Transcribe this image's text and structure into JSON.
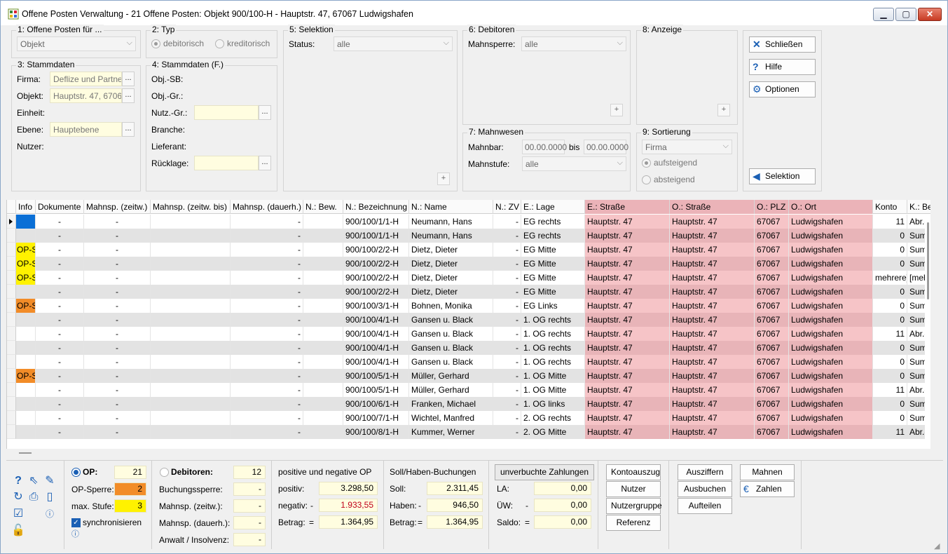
{
  "window": {
    "title": "Offene Posten Verwaltung - 21 Offene Posten:  Objekt 900/100-H - Hauptstr. 47, 67067 Ludwigshafen"
  },
  "panel1": {
    "label": "1: Offene Posten für ...",
    "select": "Objekt"
  },
  "panel2": {
    "label": "2: Typ",
    "opt1": "debitorisch",
    "opt2": "kreditorisch"
  },
  "panel3": {
    "label": "3: Stammdaten",
    "firma_l": "Firma:",
    "firma_v": "Deflize und Partne",
    "objekt_l": "Objekt:",
    "objekt_v": "Hauptstr. 47, 6706",
    "einheit_l": "Einheit:",
    "ebene_l": "Ebene:",
    "ebene_v": "Hauptebene",
    "nutzer_l": "Nutzer:"
  },
  "panel4": {
    "label": "4: Stammdaten (F.)",
    "objsb": "Obj.-SB:",
    "objgr": "Obj.-Gr.:",
    "nutzgr": "Nutz.-Gr.:",
    "branche": "Branche:",
    "lieferant": "Lieferant:",
    "ruecklage": "Rücklage:"
  },
  "panel5": {
    "label": "5: Selektion",
    "status_l": "Status:",
    "status_v": "alle"
  },
  "panel6": {
    "label": "6: Debitoren",
    "mahnsperre_l": "Mahnsperre:",
    "mahnsperre_v": "alle"
  },
  "panel7": {
    "label": "7: Mahnwesen",
    "mahnbar_l": "Mahnbar:",
    "from": "00.00.0000",
    "bis": "bis",
    "to": "00.00.0000",
    "stufe_l": "Mahnstufe:",
    "stufe_v": "alle"
  },
  "panel8": {
    "label": "8: Anzeige"
  },
  "panel9": {
    "label": "9: Sortierung",
    "select": "Firma",
    "asc": "aufsteigend",
    "desc": "absteigend"
  },
  "buttons": {
    "schliessen": "Schließen",
    "hilfe": "Hilfe",
    "optionen": "Optionen",
    "selektion": "Selektion"
  },
  "columns": [
    "Info",
    "Dokumente",
    "Mahnsp. (zeitw.)",
    "Mahnsp. (zeitw. bis)",
    "Mahnsp. (dauerh.)",
    "N.: Bew.",
    "N.: Bezeichnung",
    "N.: Name",
    "N.: ZV",
    "E.: Lage",
    "E.: Straße",
    "O.: Straße",
    "O.: PLZ",
    "O.: Ort",
    "Konto",
    "K.: Be"
  ],
  "rows": [
    {
      "info": "",
      "dok": "-",
      "mz": "-",
      "mzb": "",
      "md": "-",
      "bew": "",
      "bez": "900/100/1/1-H",
      "name": "Neumann, Hans",
      "zv": "-",
      "lage": "EG rechts",
      "es": "Hauptstr. 47",
      "os": "Hauptstr. 47",
      "plz": "67067",
      "ort": "Ludwigshafen",
      "konto": "11",
      "kb": "Abr.-I"
    },
    {
      "info": "",
      "dok": "-",
      "mz": "-",
      "mzb": "",
      "md": "-",
      "bew": "",
      "bez": "900/100/1/1-H",
      "name": "Neumann, Hans",
      "zv": "-",
      "lage": "EG rechts",
      "es": "Hauptstr. 47",
      "os": "Hauptstr. 47",
      "plz": "67067",
      "ort": "Ludwigshafen",
      "konto": "0",
      "kb": "Sumr"
    },
    {
      "info": "OP-S",
      "dok": "-",
      "mz": "-",
      "mzb": "",
      "md": "-",
      "bew": "",
      "bez": "900/100/2/2-H",
      "name": "Dietz, Dieter",
      "zv": "-",
      "lage": "EG Mitte",
      "es": "Hauptstr. 47",
      "os": "Hauptstr. 47",
      "plz": "67067",
      "ort": "Ludwigshafen",
      "konto": "0",
      "kb": "Sumr"
    },
    {
      "info": "OP-S",
      "dok": "-",
      "mz": "-",
      "mzb": "",
      "md": "-",
      "bew": "",
      "bez": "900/100/2/2-H",
      "name": "Dietz, Dieter",
      "zv": "-",
      "lage": "EG Mitte",
      "es": "Hauptstr. 47",
      "os": "Hauptstr. 47",
      "plz": "67067",
      "ort": "Ludwigshafen",
      "konto": "0",
      "kb": "Sumr"
    },
    {
      "info": "OP-S",
      "dok": "-",
      "mz": "-",
      "mzb": "",
      "md": "-",
      "bew": "",
      "bez": "900/100/2/2-H",
      "name": "Dietz, Dieter",
      "zv": "-",
      "lage": "EG Mitte",
      "es": "Hauptstr. 47",
      "os": "Hauptstr. 47",
      "plz": "67067",
      "ort": "Ludwigshafen",
      "konto": "mehrere]",
      "kb": "[meh"
    },
    {
      "info": "",
      "dok": "-",
      "mz": "-",
      "mzb": "",
      "md": "-",
      "bew": "",
      "bez": "900/100/2/2-H",
      "name": "Dietz, Dieter",
      "zv": "-",
      "lage": "EG Mitte",
      "es": "Hauptstr. 47",
      "os": "Hauptstr. 47",
      "plz": "67067",
      "ort": "Ludwigshafen",
      "konto": "0",
      "kb": "Sumr"
    },
    {
      "info": "OP-S",
      "dok": "-",
      "mz": "-",
      "mzb": "",
      "md": "-",
      "bew": "",
      "bez": "900/100/3/1-H",
      "name": "Bohnen, Monika",
      "zv": "-",
      "lage": "EG Links",
      "es": "Hauptstr. 47",
      "os": "Hauptstr. 47",
      "plz": "67067",
      "ort": "Ludwigshafen",
      "konto": "0",
      "kb": "Sumr"
    },
    {
      "info": "",
      "dok": "-",
      "mz": "-",
      "mzb": "",
      "md": "-",
      "bew": "",
      "bez": "900/100/4/1-H",
      "name": "Gansen u. Black",
      "zv": "-",
      "lage": "1. OG rechts",
      "es": "Hauptstr. 47",
      "os": "Hauptstr. 47",
      "plz": "67067",
      "ort": "Ludwigshafen",
      "konto": "0",
      "kb": "Sumr"
    },
    {
      "info": "",
      "dok": "-",
      "mz": "-",
      "mzb": "",
      "md": "-",
      "bew": "",
      "bez": "900/100/4/1-H",
      "name": "Gansen u. Black",
      "zv": "-",
      "lage": "1. OG rechts",
      "es": "Hauptstr. 47",
      "os": "Hauptstr. 47",
      "plz": "67067",
      "ort": "Ludwigshafen",
      "konto": "11",
      "kb": "Abr.-I"
    },
    {
      "info": "",
      "dok": "-",
      "mz": "-",
      "mzb": "",
      "md": "-",
      "bew": "",
      "bez": "900/100/4/1-H",
      "name": "Gansen u. Black",
      "zv": "-",
      "lage": "1. OG rechts",
      "es": "Hauptstr. 47",
      "os": "Hauptstr. 47",
      "plz": "67067",
      "ort": "Ludwigshafen",
      "konto": "0",
      "kb": "Sumr"
    },
    {
      "info": "",
      "dok": "-",
      "mz": "-",
      "mzb": "",
      "md": "-",
      "bew": "",
      "bez": "900/100/4/1-H",
      "name": "Gansen u. Black",
      "zv": "-",
      "lage": "1. OG rechts",
      "es": "Hauptstr. 47",
      "os": "Hauptstr. 47",
      "plz": "67067",
      "ort": "Ludwigshafen",
      "konto": "0",
      "kb": "Sumr"
    },
    {
      "info": "OP-S",
      "dok": "-",
      "mz": "-",
      "mzb": "",
      "md": "-",
      "bew": "",
      "bez": "900/100/5/1-H",
      "name": "Müller, Gerhard",
      "zv": "-",
      "lage": "1. OG Mitte",
      "es": "Hauptstr. 47",
      "os": "Hauptstr. 47",
      "plz": "67067",
      "ort": "Ludwigshafen",
      "konto": "0",
      "kb": "Sumr"
    },
    {
      "info": "",
      "dok": "-",
      "mz": "-",
      "mzb": "",
      "md": "-",
      "bew": "",
      "bez": "900/100/5/1-H",
      "name": "Müller, Gerhard",
      "zv": "-",
      "lage": "1. OG Mitte",
      "es": "Hauptstr. 47",
      "os": "Hauptstr. 47",
      "plz": "67067",
      "ort": "Ludwigshafen",
      "konto": "11",
      "kb": "Abr.-I"
    },
    {
      "info": "",
      "dok": "-",
      "mz": "-",
      "mzb": "",
      "md": "-",
      "bew": "",
      "bez": "900/100/6/1-H",
      "name": "Franken, Michael",
      "zv": "-",
      "lage": "1. OG links",
      "es": "Hauptstr. 47",
      "os": "Hauptstr. 47",
      "plz": "67067",
      "ort": "Ludwigshafen",
      "konto": "0",
      "kb": "Sumr"
    },
    {
      "info": "",
      "dok": "-",
      "mz": "-",
      "mzb": "",
      "md": "-",
      "bew": "",
      "bez": "900/100/7/1-H",
      "name": "Wichtel, Manfred",
      "zv": "-",
      "lage": "2. OG rechts",
      "es": "Hauptstr. 47",
      "os": "Hauptstr. 47",
      "plz": "67067",
      "ort": "Ludwigshafen",
      "konto": "0",
      "kb": "Sumr"
    },
    {
      "info": "",
      "dok": "-",
      "mz": "-",
      "mzb": "",
      "md": "-",
      "bew": "",
      "bez": "900/100/8/1-H",
      "name": "Kummer, Werner",
      "zv": "-",
      "lage": "2. OG Mitte",
      "es": "Hauptstr. 47",
      "os": "Hauptstr. 47",
      "plz": "67067",
      "ort": "Ludwigshafen",
      "konto": "11",
      "kb": "Abr.-I"
    }
  ],
  "colors": {
    "info_yellow": "#fff200",
    "info_orange": "#f28c28",
    "info_blue": "#0a6fd6",
    "pink": "#f6c4c7",
    "pink_alt": "#e8b4b8"
  },
  "op": {
    "op_l": "OP:",
    "op_v": "21",
    "sperre_l": "OP-Sperre:",
    "sperre_v": "2",
    "stufe_l": "max. Stufe:",
    "stufe_v": "3",
    "sync": "synchronisieren"
  },
  "deb": {
    "title": "Debitoren:",
    "count": "12",
    "buchung": "Buchungssperre:",
    "mzw": "Mahnsp. (zeitw.):",
    "mdh": "Mahnsp. (dauerh.):",
    "anwalt": "Anwalt / Insolvenz:",
    "dash": "-"
  },
  "posneg": {
    "title": "positive und negative OP",
    "pos_l": "positiv:",
    "pos_v": "3.298,50",
    "neg_l": "negativ:",
    "neg_sign": "-",
    "neg_v": "1.933,55",
    "bet_l": "Betrag:",
    "eq": "=",
    "bet_v": "1.364,95"
  },
  "sollhaben": {
    "title": "Soll/Haben-Buchungen",
    "soll_l": "Soll:",
    "soll_v": "2.311,45",
    "haben_l": "Haben:",
    "minus": "-",
    "haben_v": "946,50",
    "bet_l": "Betrag:",
    "eq": "=",
    "bet_v": "1.364,95"
  },
  "unbuch": {
    "btn": "unverbuchte Zahlungen",
    "la_l": "LA:",
    "la_v": "0,00",
    "uew_l": "ÜW:",
    "minus": "-",
    "uew_v": "0,00",
    "saldo_l": "Saldo:",
    "eq": "=",
    "saldo_v": "0,00"
  },
  "actions": {
    "kontoauszug": "Kontoauszug",
    "nutzer": "Nutzer",
    "nutzergruppe": "Nutzergruppe",
    "referenz": "Referenz",
    "ausziffern": "Ausziffern",
    "mahnen": "Mahnen",
    "ausbuchen": "Ausbuchen",
    "zahlen": "Zahlen",
    "aufteilen": "Aufteilen"
  }
}
